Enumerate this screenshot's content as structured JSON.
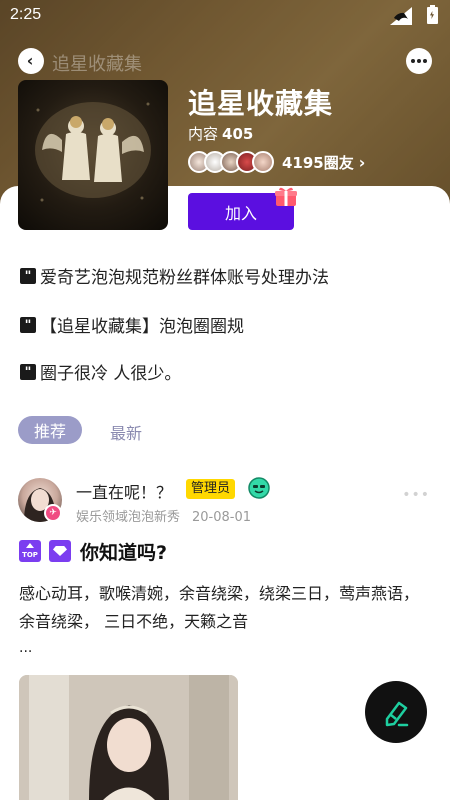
{
  "status_bar": {
    "time": "2:25"
  },
  "header": {
    "ghost_title": "追星收藏集",
    "circle_title": "追星收藏集",
    "content_label": "内容",
    "content_count": "405",
    "member_count": "4195圈友",
    "join_label": "加入"
  },
  "rules": [
    {
      "text": "爱奇艺泡泡规范粉丝群体账号处理办法"
    },
    {
      "text": "【追星收藏集】泡泡圈圈规"
    },
    {
      "text": "圈子很冷  人很少。"
    }
  ],
  "tabs": {
    "recommend": "推荐",
    "latest": "最新"
  },
  "post": {
    "author": "一直在呢！？",
    "role_badge": "管理员",
    "source": "娱乐领域泡泡新秀",
    "date": "20-08-01",
    "top_tag": "TOP",
    "title": "你知道吗?",
    "body": "感心动耳，歌喉清婉，余音绕梁，绕梁三日，莺声燕语，余音绕梁， 三日不绝，天籁之音",
    "ellipsis": "..."
  },
  "icons": {
    "back": "back-arrow-icon",
    "more": "more-icon",
    "gift": "gift-icon",
    "quote": "quote-icon",
    "edit": "edit-pen-icon",
    "level": "level-face-icon"
  },
  "colors": {
    "join": "#5b0fe0",
    "tab_active": "#9b9cc8",
    "admin_badge": "#ffd800",
    "tag_purple": "#7b3df0",
    "fab_accent": "#1ecfa0"
  }
}
